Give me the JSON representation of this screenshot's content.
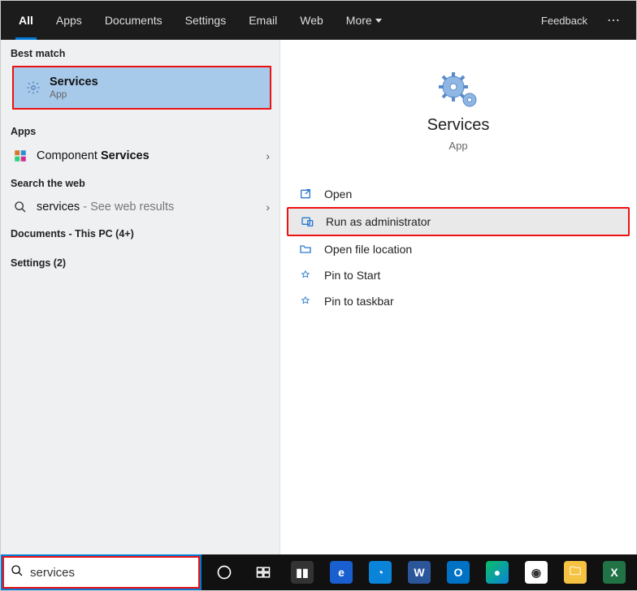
{
  "topbar": {
    "tabs": [
      "All",
      "Apps",
      "Documents",
      "Settings",
      "Email",
      "Web",
      "More"
    ],
    "feedback": "Feedback"
  },
  "left": {
    "best_match_label": "Best match",
    "best_match": {
      "title": "Services",
      "subtitle": "App"
    },
    "apps_label": "Apps",
    "apps_item": {
      "prefix": "Component ",
      "strong": "Services"
    },
    "search_web_label": "Search the web",
    "web_item": {
      "query": "services",
      "suffix": " - See web results"
    },
    "documents_label": "Documents - This PC (4+)",
    "settings_label": "Settings (2)"
  },
  "right": {
    "hero_title": "Services",
    "hero_subtitle": "App",
    "actions": {
      "open": "Open",
      "run_admin": "Run as administrator",
      "open_location": "Open file location",
      "pin_start": "Pin to Start",
      "pin_taskbar": "Pin to taskbar"
    }
  },
  "search": {
    "value": "services"
  },
  "taskbar": {
    "icons": [
      "cortana-circle",
      "task-view",
      "library",
      "chrome",
      "edge",
      "word",
      "outlook",
      "edge-chromium",
      "chrome2",
      "file-explorer",
      "excel",
      "teams"
    ]
  }
}
